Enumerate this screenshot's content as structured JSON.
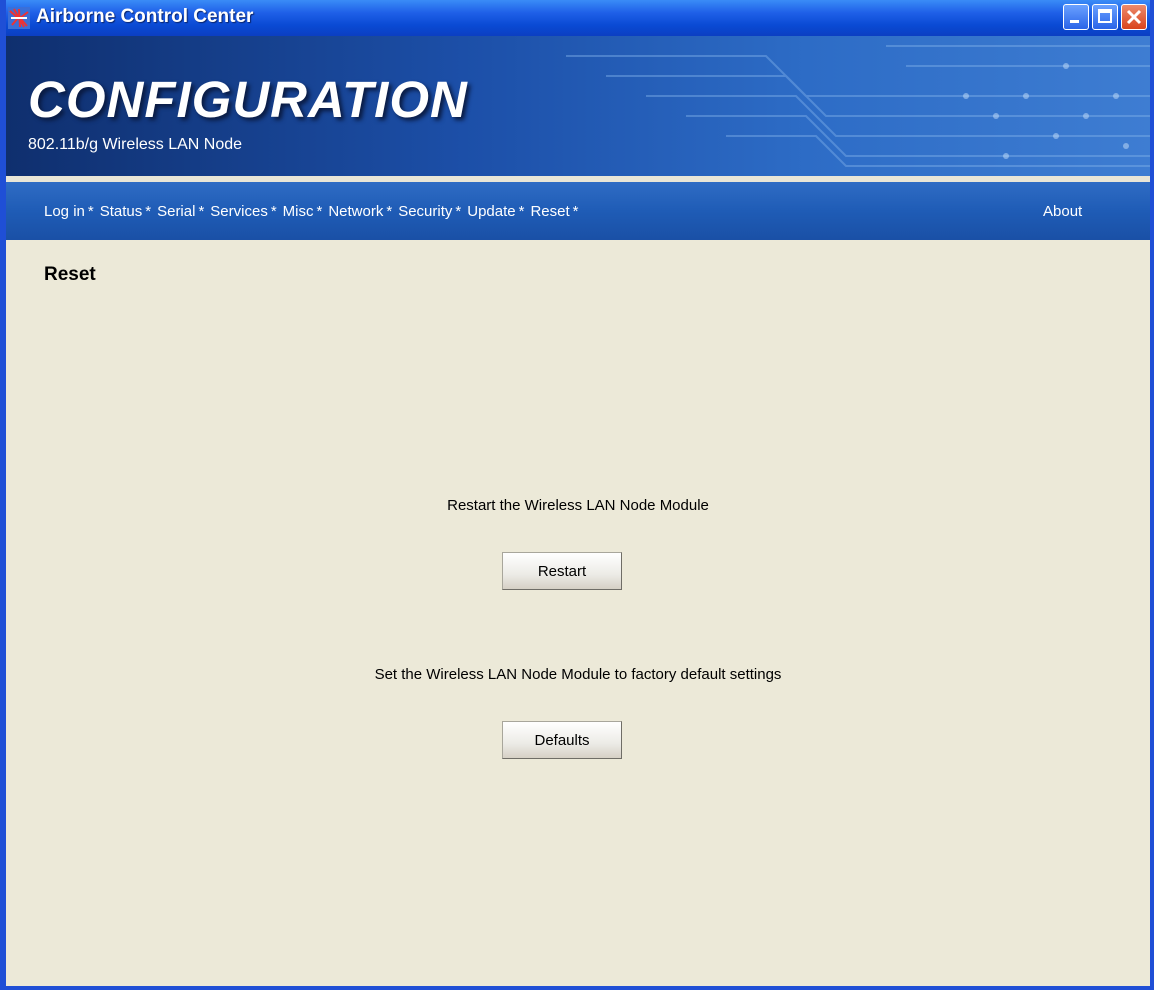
{
  "window": {
    "title": "Airborne Control Center",
    "icon": "airborne-app-icon"
  },
  "banner": {
    "title": "CONFIGURATION",
    "subtitle": "802.11b/g Wireless LAN Node"
  },
  "nav": {
    "items": [
      {
        "label": "Log in"
      },
      {
        "label": "Status"
      },
      {
        "label": "Serial"
      },
      {
        "label": "Services"
      },
      {
        "label": "Misc"
      },
      {
        "label": "Network"
      },
      {
        "label": "Security"
      },
      {
        "label": "Update"
      },
      {
        "label": "Reset"
      }
    ],
    "separator": "*",
    "about": "About"
  },
  "page": {
    "heading": "Reset",
    "restart_text": "Restart the Wireless LAN Node Module",
    "restart_button": "Restart",
    "defaults_text": "Set the Wireless LAN Node Module to factory default settings",
    "defaults_button": "Defaults"
  },
  "colors": {
    "titlebar": "#0a4ad4",
    "navbar": "#1f5cb6",
    "content_bg": "#ece9d8",
    "close_button": "#d9431c"
  }
}
